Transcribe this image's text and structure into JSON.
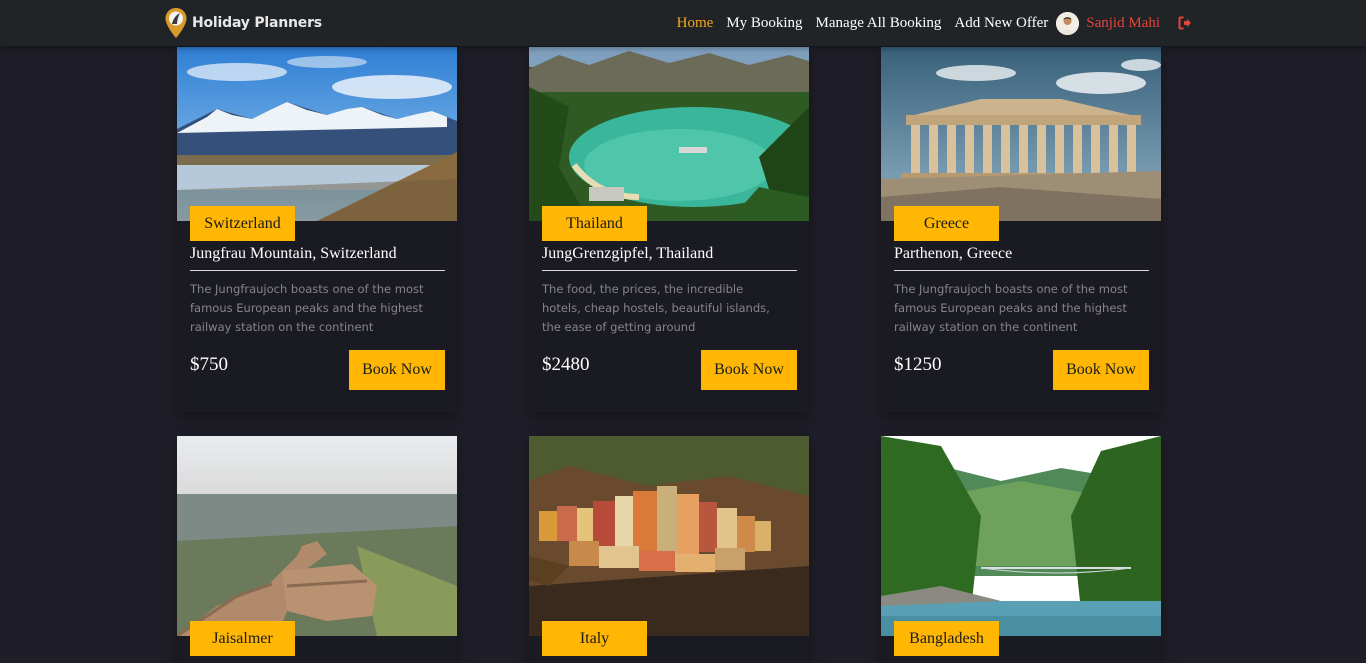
{
  "brand": {
    "name": "Holiday Planners"
  },
  "nav": {
    "links": [
      "Home",
      "My Booking",
      "Manage All Booking",
      "Add New Offer"
    ],
    "user_name": "Sanjid Mahi",
    "active_color": "#f5a623",
    "user_color": "#e4453a"
  },
  "colors": {
    "accent": "#ffb703",
    "background": "#1f1e28",
    "card": "#1a1a22"
  },
  "cards": [
    {
      "country": "Switzerland",
      "title": "Jungfrau Mountain, Switzerland",
      "description": "The Jungfraujoch boasts one of the most famous European peaks and the highest railway station on the continent",
      "price": "$750",
      "button": "Book Now"
    },
    {
      "country": "Thailand",
      "title": "JungGrenzgipfel, Thailand",
      "description": "The food, the prices, the incredible hotels, cheap hostels, beautiful islands, the ease of getting around",
      "price": "$2480",
      "button": "Book Now"
    },
    {
      "country": "Greece",
      "title": "Parthenon, Greece",
      "description": "The Jungfraujoch boasts one of the most famous European peaks and the highest railway station on the continent",
      "price": "$1250",
      "button": "Book Now"
    },
    {
      "country": "Jaisalmer"
    },
    {
      "country": "Italy"
    },
    {
      "country": "Bangladesh"
    }
  ]
}
